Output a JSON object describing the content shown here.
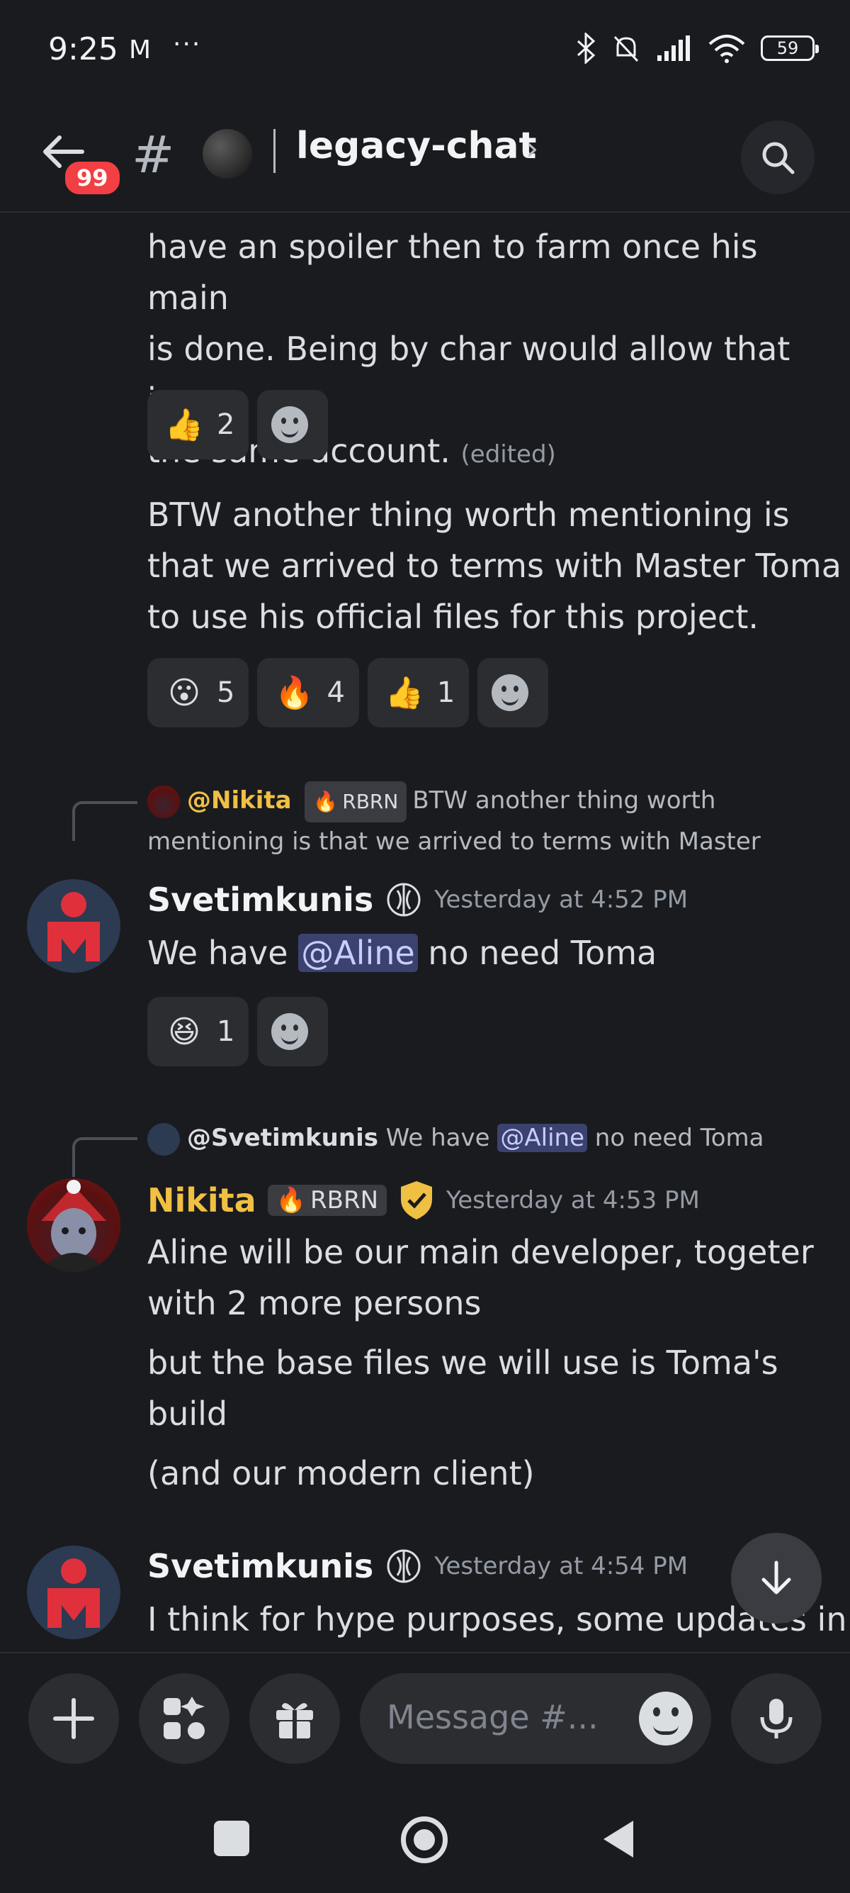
{
  "status_bar": {
    "time": "9:25",
    "mail_icon": "M",
    "more": "···",
    "battery": "59"
  },
  "header": {
    "unread_badge": "99",
    "channel_prefix": "#",
    "channel_name": "legacy-chat",
    "chevron": "›"
  },
  "messages": [
    {
      "id": "m1",
      "lines": [
        "have an spoiler then to farm once his main",
        "is done. Being by char would allow that in",
        "the same account."
      ],
      "edited": "(edited)",
      "reactions": [
        {
          "emoji": "👍",
          "count": "2"
        }
      ]
    },
    {
      "id": "m2",
      "lines": [
        "BTW another thing worth mentioning is",
        "that we arrived to terms with Master Toma",
        "to use his official files for this project."
      ],
      "reactions": [
        {
          "emoji": "😮",
          "count": "5"
        },
        {
          "emoji": "🔥",
          "count": "4"
        },
        {
          "emoji": "👍",
          "count": "1"
        }
      ]
    },
    {
      "id": "m3",
      "reply": {
        "author": "@Nikita",
        "role": "RBRN",
        "line1": "BTW another thing worth",
        "line2": "mentioning is that we arrived to terms with Master"
      },
      "author": "Svetimkunis",
      "timestamp": "Yesterday at 4:52 PM",
      "text_before": "We have ",
      "mention": "@Aline",
      "text_after": " no need Toma",
      "reactions": [
        {
          "emoji": "😆",
          "count": "1"
        }
      ]
    },
    {
      "id": "m4",
      "reply": {
        "author": "@Svetimkunis",
        "text_before": "We have ",
        "mention": "@Aline",
        "text_after": " no need Toma"
      },
      "author": "Nikita",
      "role": "RBRN",
      "timestamp": "Yesterday at 4:53 PM",
      "paragraphs": [
        [
          "Aline will be our main developer, togeter",
          "with 2 more persons"
        ],
        [
          "but the base files we will use is Toma's",
          "build"
        ],
        [
          "(and our modern client)"
        ]
      ]
    },
    {
      "id": "m5",
      "author": "Svetimkunis",
      "timestamp": "Yesterday at 4:54 PM",
      "line1": "I think for hype purposes, some updates in"
    }
  ],
  "composer": {
    "placeholder": "Message #..."
  },
  "colors": {
    "background": "#1a1b1f",
    "nikita_name": "#f0c043",
    "mention_bg": "#3c4270",
    "badge_red": "#f23f43"
  }
}
